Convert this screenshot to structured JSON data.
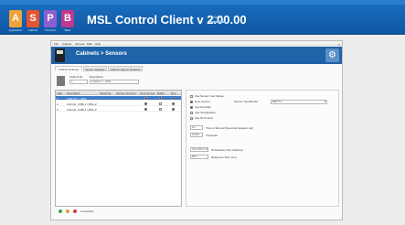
{
  "app_bar": {
    "title": "MSL Control Client  v 2.00.00",
    "tiles": [
      {
        "letter": "A",
        "color": "#f0a23a",
        "caption": "Application"
      },
      {
        "letter": "S",
        "color": "#e5542d",
        "caption": "Cabinet"
      },
      {
        "letter": "P",
        "color": "#8b5fd0",
        "caption": "Protocol"
      },
      {
        "letter": "B",
        "color": "#c0398f",
        "caption": "Bake"
      }
    ],
    "link": "Status"
  },
  "window": {
    "menu": [
      "File",
      "Cabinet",
      "Sensors",
      "MSL",
      "Help"
    ],
    "close": "x",
    "header_text": "Cabinets  >  Sensors",
    "header_icon": "gear-icon",
    "tabs": [
      "Cabinet Settings",
      "Sensor Settings",
      "Cabinet Sensor Readers"
    ],
    "id_labels": {
      "cabinet_id": "Cabinet ID",
      "description": "Description"
    },
    "id_values": {
      "cabinet_id": "1",
      "description": "Cabinet 1 - MSL"
    },
    "grid": {
      "columns": [
        "Addr",
        "Description",
        "Serial No.",
        "Sensor Channel",
        "Hum Sensor",
        "Buffer",
        "Run"
      ],
      "rows": [
        {
          "addr": "1",
          "desc": "Cabinet 1 - MSL",
          "serial": "",
          "chan": "",
          "hum": true,
          "buf": true,
          "run": true
        },
        {
          "addr": "2",
          "desc": "Cab No. 2 DB-1 / MSL-2",
          "serial": "",
          "chan": "",
          "hum": true,
          "buf": false,
          "run": true
        },
        {
          "addr": "3",
          "desc": "Cab No. 3 DB-1 / MSL-3",
          "serial": "",
          "chan": "",
          "hum": true,
          "buf": false,
          "run": true
        }
      ]
    },
    "footer_buttons": [
      {
        "name": "add-icon",
        "color": "#3aa34b"
      },
      {
        "name": "remove-icon",
        "color": "#d9a13a"
      },
      {
        "name": "delete-icon",
        "color": "#d33b3b"
      }
    ],
    "footer_text": "1 record(s)",
    "settings": {
      "options": [
        {
          "label": "Use Sensor Use Range",
          "on": false
        },
        {
          "label": "Dew Control",
          "on": true
        },
        {
          "label": "Use Humidity",
          "on": true
        },
        {
          "label": "Use Temperature",
          "on": false
        },
        {
          "label": "Use ID Control",
          "on": false
        }
      ],
      "sensor_type_label": "Sensor Type/Model",
      "sensor_type_value": "SHT 7x",
      "edit_rows": [
        {
          "value": "10",
          "label": "Time of Interval (Seconds between cal)"
        },
        {
          "value": "2,000",
          "label": "Timespan"
        }
      ],
      "ip_rows": [
        {
          "value": "192.168.0.100",
          "label": "IP Address (Your Cabinet)"
        },
        {
          "value": "502",
          "label": "Response Time (ms)"
        }
      ]
    }
  }
}
